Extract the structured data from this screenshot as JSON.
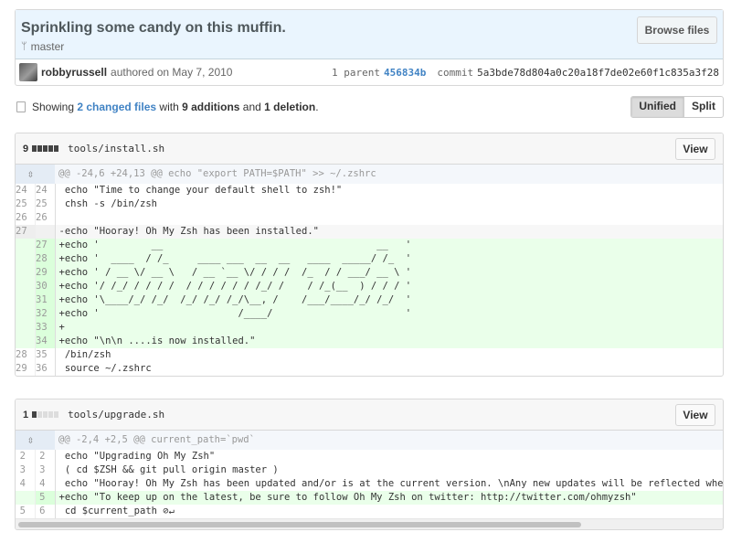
{
  "commit": {
    "title": "Sprinkling some candy on this muffin.",
    "branch": "master",
    "browse_label": "Browse files",
    "author": "robbyrussell",
    "authored_text": "authored on May 7, 2010",
    "parent_label": "1 parent",
    "parent_sha": "456834b",
    "commit_label": "commit",
    "commit_sha": "5a3bde78d804a0c20a18f7de02e60f1c835a3f28"
  },
  "toc": {
    "showing": "Showing",
    "changed_files": "2 changed files",
    "with": "with",
    "additions": "9 additions",
    "and": "and",
    "deletions": "1 deletion",
    "period": ".",
    "unified_label": "Unified",
    "split_label": "Split"
  },
  "files": [
    {
      "count": "9",
      "path": "tools/install.sh",
      "view_label": "View",
      "hunk": "@@ -24,6 +24,13 @@ echo \"export PATH=$PATH\" >> ~/.zshrc",
      "lines": [
        {
          "type": "ctx",
          "old": "24",
          "new": "24",
          "text": " echo \"Time to change your default shell to zsh!\""
        },
        {
          "type": "ctx",
          "old": "25",
          "new": "25",
          "text": " chsh -s /bin/zsh"
        },
        {
          "type": "ctx",
          "old": "26",
          "new": "26",
          "text": ""
        },
        {
          "type": "del",
          "old": "27",
          "new": "",
          "text": "-echo \"Hooray! Oh My Zsh has been installed.\""
        },
        {
          "type": "add",
          "old": "",
          "new": "27",
          "text": "+echo '         __                                     __   '"
        },
        {
          "type": "add",
          "old": "",
          "new": "28",
          "text": "+echo '  ____  / /_     ____ ___  __  __   ____  _____/ /_  '"
        },
        {
          "type": "add",
          "old": "",
          "new": "29",
          "text": "+echo ' / __ \\/ __ \\   / __ `__ \\/ / / /  /_  / / ___/ __ \\ '"
        },
        {
          "type": "add",
          "old": "",
          "new": "30",
          "text": "+echo '/ /_/ / / / /  / / / / / / /_/ /    / /_(__  ) / / / '"
        },
        {
          "type": "add",
          "old": "",
          "new": "31",
          "text": "+echo '\\____/_/ /_/  /_/ /_/ /_/\\__, /    /___/____/_/ /_/  '"
        },
        {
          "type": "add",
          "old": "",
          "new": "32",
          "text": "+echo '                        /____/                       '"
        },
        {
          "type": "add",
          "old": "",
          "new": "33",
          "text": "+"
        },
        {
          "type": "add",
          "old": "",
          "new": "34",
          "text": "+echo \"\\n\\n ....is now installed.\""
        },
        {
          "type": "ctx",
          "old": "28",
          "new": "35",
          "text": " /bin/zsh"
        },
        {
          "type": "ctx",
          "old": "29",
          "new": "36",
          "text": " source ~/.zshrc"
        }
      ]
    },
    {
      "count": "1",
      "path": "tools/upgrade.sh",
      "view_label": "View",
      "hunk": "@@ -2,4 +2,5 @@ current_path=`pwd`",
      "lines": [
        {
          "type": "ctx",
          "old": "2",
          "new": "2",
          "text": " echo \"Upgrading Oh My Zsh\""
        },
        {
          "type": "ctx",
          "old": "3",
          "new": "3",
          "text": " ( cd $ZSH && git pull origin master )"
        },
        {
          "type": "ctx",
          "old": "4",
          "new": "4",
          "text": " echo \"Hooray! Oh My Zsh has been updated and/or is at the current version. \\nAny new updates will be reflected when you st"
        },
        {
          "type": "add",
          "old": "",
          "new": "5",
          "text": "+echo \"To keep up on the latest, be sure to follow Oh My Zsh on twitter: http://twitter.com/ohmyzsh\""
        },
        {
          "type": "ctx",
          "old": "5",
          "new": "6",
          "text": " cd $current_path ⊘↵"
        }
      ]
    }
  ],
  "colors": {
    "link": "#4183c4",
    "add_bg": "#eaffea",
    "add_num_bg": "#dbffdb",
    "header_bg": "#eaf5fe"
  }
}
